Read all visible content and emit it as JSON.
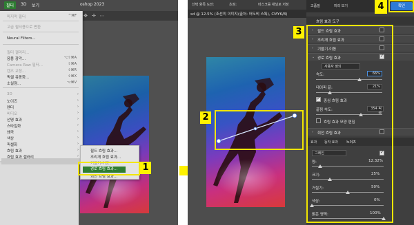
{
  "left": {
    "menubar": {
      "filter": "필터",
      "threed": "3D",
      "view": "보기",
      "ps_title": "oshop 2023"
    },
    "filter_menu": {
      "items": [
        {
          "label": "마지막 필터",
          "shortcut": "^⌘F",
          "dim": true
        },
        {
          "label": "고급 필터용으로 변환",
          "shortcut": "",
          "dim": true
        },
        {
          "label": "Neural Filters...",
          "shortcut": "",
          "dim": false
        },
        {
          "label": "필터 갤러리...",
          "shortcut": "",
          "dim": true
        },
        {
          "label": "응용 광각...",
          "shortcut": "⌥⇧⌘A",
          "dim": false
        },
        {
          "label": "Camera Raw 필터...",
          "shortcut": "⇧⌘A",
          "dim": true
        },
        {
          "label": "렌즈 교정...",
          "shortcut": "⇧⌘R",
          "dim": true
        },
        {
          "label": "픽셀 유동화...",
          "shortcut": "⇧⌘X",
          "dim": false
        },
        {
          "label": "소실점...",
          "shortcut": "⌥⌘V",
          "dim": false
        },
        {
          "label": "3D",
          "shortcut": "",
          "dim": true
        },
        {
          "label": "노이즈",
          "shortcut": "",
          "dim": false
        },
        {
          "label": "렌더",
          "shortcut": "",
          "dim": false
        },
        {
          "label": "비디오",
          "shortcut": "",
          "dim": true
        },
        {
          "label": "선명 효과",
          "shortcut": "",
          "dim": false
        },
        {
          "label": "스타일화",
          "shortcut": "",
          "dim": false
        },
        {
          "label": "왜곡",
          "shortcut": "",
          "dim": false
        },
        {
          "label": "색상",
          "shortcut": "",
          "dim": false
        },
        {
          "label": "픽셀화",
          "shortcut": "",
          "dim": false
        },
        {
          "label": "흐림 효과",
          "shortcut": "",
          "dim": false
        },
        {
          "label": "흐림 효과 갤러리",
          "shortcut": "",
          "dim": false
        },
        {
          "label": "기타",
          "shortcut": "",
          "dim": false
        }
      ]
    },
    "submenu": {
      "items": [
        {
          "label": "필드 흐림 효과...",
          "selected": false
        },
        {
          "label": "조리개 흐림 효과...",
          "selected": false
        },
        {
          "label": "기울기-이동...",
          "selected": false
        },
        {
          "label": "경로 흐림 효과...",
          "selected": true
        },
        {
          "label": "회전 흐림 효과...",
          "selected": false
        }
      ]
    }
  },
  "center": {
    "options_bar": {
      "a": "선택 항목 도전:",
      "b": "초점:",
      "c": "마스크를 채널로 저장",
      "d": "고품질",
      "e": "미리 보기",
      "f": "스크린 도구"
    },
    "doc_tab": "sd @ 12.5% (조선미 이미지(출처: 어도비 스톡), CMYK/8)"
  },
  "right": {
    "top_bar": {
      "title": "흐림 효과 도구",
      "ok": "확인"
    },
    "sections": [
      {
        "label": "필드 흐림 효과",
        "checked": false
      },
      {
        "label": "조리개 흐림 효과",
        "checked": false
      },
      {
        "label": "기울기-이동",
        "checked": false
      },
      {
        "label": "경로 흐림 효과",
        "checked": true
      }
    ],
    "path_blur": {
      "mode": "사용자 정의",
      "speed_label": "속도:",
      "speed_value": "66%",
      "speed_level": 0.66,
      "taper_label": "테이퍼 끝:",
      "taper_value": "21%",
      "taper_level": 0.21,
      "center_blur_label": "중심 흐림 효과",
      "end_speed_label": "끝점 속도:",
      "end_speed_value": "354 픽셀",
      "end_speed_level": 0.68,
      "edit_shapes_label": "흐림 효과 모양 편집"
    },
    "spin_section": {
      "label": "회전 흐림 효과",
      "checked": false
    },
    "subtabs": {
      "a": "효과",
      "b": "동작 효과",
      "c": "노이즈"
    },
    "noise": {
      "type": "그레인",
      "amount_label": "양:",
      "amount_value": "12.32%",
      "amount_level": 0.12,
      "size_label": "크기:",
      "size_value": "25%",
      "size_level": 0.25,
      "roughness_label": "거칠기:",
      "roughness_value": "50%",
      "roughness_level": 0.5,
      "color_label": "색상:",
      "color_value": "0%",
      "color_level": 0.0,
      "highlights_label": "밝은 영역:",
      "highlights_value": "100%",
      "highlights_level": 1.0
    }
  },
  "callouts": {
    "n1": "1",
    "n2": "2",
    "n3": "3",
    "n4": "4"
  },
  "colors": {
    "accent_yellow": "#fff200",
    "menu_selected_green": "#2e7d32",
    "ok_blue": "#2e7bd6"
  }
}
